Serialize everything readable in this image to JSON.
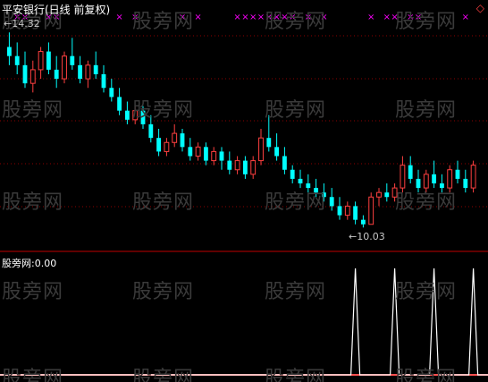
{
  "title": "平安银行(日线 前复权)",
  "corner_icon": "diamond-icon",
  "watermark_text": "股旁网",
  "high_label": "14.32",
  "low_label": "10.03",
  "indicator": {
    "name": "股旁网",
    "separator": ":",
    "value": "0.00"
  },
  "colors": {
    "background": "#000000",
    "up": "#ff4040",
    "down": "#00ffff",
    "grid": "#8b0000",
    "marker": "#ff00ff",
    "spike": "#ffffff",
    "baseline": "#ff5050"
  },
  "chart_data": [
    {
      "type": "candlestick",
      "title": "平安银行(日线 前复权)",
      "y_range": [
        9.8,
        14.6
      ],
      "annotations": [
        {
          "label": "14.32",
          "type": "high"
        },
        {
          "label": "10.03",
          "type": "low"
        }
      ],
      "candles": [
        {
          "o": 14.0,
          "h": 14.32,
          "l": 13.6,
          "c": 13.8
        },
        {
          "o": 13.8,
          "h": 14.1,
          "l": 13.4,
          "c": 13.6
        },
        {
          "o": 13.6,
          "h": 13.9,
          "l": 13.1,
          "c": 13.2
        },
        {
          "o": 13.2,
          "h": 13.7,
          "l": 13.0,
          "c": 13.5
        },
        {
          "o": 13.5,
          "h": 14.0,
          "l": 13.3,
          "c": 13.9
        },
        {
          "o": 13.9,
          "h": 14.1,
          "l": 13.4,
          "c": 13.5
        },
        {
          "o": 13.5,
          "h": 13.8,
          "l": 13.1,
          "c": 13.3
        },
        {
          "o": 13.3,
          "h": 13.9,
          "l": 13.2,
          "c": 13.8
        },
        {
          "o": 13.8,
          "h": 14.2,
          "l": 13.5,
          "c": 13.6
        },
        {
          "o": 13.6,
          "h": 13.8,
          "l": 13.2,
          "c": 13.3
        },
        {
          "o": 13.3,
          "h": 13.7,
          "l": 13.1,
          "c": 13.6
        },
        {
          "o": 13.6,
          "h": 13.9,
          "l": 13.3,
          "c": 13.4
        },
        {
          "o": 13.4,
          "h": 13.6,
          "l": 13.0,
          "c": 13.1
        },
        {
          "o": 13.1,
          "h": 13.3,
          "l": 12.8,
          "c": 12.9
        },
        {
          "o": 12.9,
          "h": 13.1,
          "l": 12.5,
          "c": 12.6
        },
        {
          "o": 12.6,
          "h": 12.8,
          "l": 12.3,
          "c": 12.4
        },
        {
          "o": 12.4,
          "h": 12.7,
          "l": 12.3,
          "c": 12.6
        },
        {
          "o": 12.6,
          "h": 12.7,
          "l": 12.2,
          "c": 12.3
        },
        {
          "o": 12.3,
          "h": 12.5,
          "l": 11.9,
          "c": 12.0
        },
        {
          "o": 12.0,
          "h": 12.2,
          "l": 11.6,
          "c": 11.7
        },
        {
          "o": 11.7,
          "h": 12.0,
          "l": 11.6,
          "c": 11.9
        },
        {
          "o": 11.9,
          "h": 12.3,
          "l": 11.8,
          "c": 12.1
        },
        {
          "o": 12.1,
          "h": 12.2,
          "l": 11.7,
          "c": 11.8
        },
        {
          "o": 11.8,
          "h": 12.0,
          "l": 11.5,
          "c": 11.6
        },
        {
          "o": 11.6,
          "h": 11.9,
          "l": 11.5,
          "c": 11.8
        },
        {
          "o": 11.8,
          "h": 11.9,
          "l": 11.4,
          "c": 11.5
        },
        {
          "o": 11.5,
          "h": 11.8,
          "l": 11.4,
          "c": 11.7
        },
        {
          "o": 11.7,
          "h": 11.8,
          "l": 11.3,
          "c": 11.5
        },
        {
          "o": 11.5,
          "h": 11.7,
          "l": 11.2,
          "c": 11.3
        },
        {
          "o": 11.3,
          "h": 11.6,
          "l": 11.2,
          "c": 11.5
        },
        {
          "o": 11.5,
          "h": 11.6,
          "l": 11.1,
          "c": 11.2
        },
        {
          "o": 11.2,
          "h": 11.6,
          "l": 11.1,
          "c": 11.5
        },
        {
          "o": 11.5,
          "h": 12.2,
          "l": 11.4,
          "c": 12.0
        },
        {
          "o": 12.0,
          "h": 12.5,
          "l": 11.7,
          "c": 11.8
        },
        {
          "o": 11.8,
          "h": 12.1,
          "l": 11.5,
          "c": 11.6
        },
        {
          "o": 11.6,
          "h": 11.8,
          "l": 11.2,
          "c": 11.3
        },
        {
          "o": 11.3,
          "h": 11.4,
          "l": 11.0,
          "c": 11.1
        },
        {
          "o": 11.1,
          "h": 11.3,
          "l": 10.9,
          "c": 11.0
        },
        {
          "o": 11.0,
          "h": 11.2,
          "l": 10.8,
          "c": 10.9
        },
        {
          "o": 10.9,
          "h": 11.1,
          "l": 10.7,
          "c": 10.8
        },
        {
          "o": 10.8,
          "h": 11.0,
          "l": 10.6,
          "c": 10.7
        },
        {
          "o": 10.7,
          "h": 10.9,
          "l": 10.4,
          "c": 10.5
        },
        {
          "o": 10.5,
          "h": 10.7,
          "l": 10.2,
          "c": 10.3
        },
        {
          "o": 10.3,
          "h": 10.6,
          "l": 10.2,
          "c": 10.5
        },
        {
          "o": 10.5,
          "h": 10.6,
          "l": 10.1,
          "c": 10.2
        },
        {
          "o": 10.2,
          "h": 10.3,
          "l": 10.03,
          "c": 10.1
        },
        {
          "o": 10.1,
          "h": 10.8,
          "l": 10.1,
          "c": 10.7
        },
        {
          "o": 10.7,
          "h": 10.9,
          "l": 10.5,
          "c": 10.8
        },
        {
          "o": 10.8,
          "h": 11.0,
          "l": 10.6,
          "c": 10.7
        },
        {
          "o": 10.7,
          "h": 11.0,
          "l": 10.6,
          "c": 10.9
        },
        {
          "o": 10.9,
          "h": 11.6,
          "l": 10.8,
          "c": 11.4
        },
        {
          "o": 11.4,
          "h": 11.6,
          "l": 11.0,
          "c": 11.1
        },
        {
          "o": 11.1,
          "h": 11.3,
          "l": 10.8,
          "c": 10.9
        },
        {
          "o": 10.9,
          "h": 11.3,
          "l": 10.8,
          "c": 11.2
        },
        {
          "o": 11.2,
          "h": 11.5,
          "l": 10.9,
          "c": 11.0
        },
        {
          "o": 11.0,
          "h": 11.2,
          "l": 10.8,
          "c": 10.9
        },
        {
          "o": 10.9,
          "h": 11.4,
          "l": 10.8,
          "c": 11.3
        },
        {
          "o": 11.3,
          "h": 11.5,
          "l": 11.0,
          "c": 11.1
        },
        {
          "o": 11.1,
          "h": 11.3,
          "l": 10.8,
          "c": 10.9
        },
        {
          "o": 10.9,
          "h": 11.5,
          "l": 10.8,
          "c": 11.4
        }
      ]
    },
    {
      "type": "line",
      "name": "股旁网",
      "value_label": "0.00",
      "spikes_at_index": [
        44,
        49,
        54,
        59
      ],
      "baseline": 0,
      "spike_value": 1
    }
  ],
  "markers": {
    "symbol": "×",
    "indices": [
      1,
      2,
      5,
      6,
      14,
      16,
      22,
      24,
      29,
      30,
      31,
      32,
      33,
      34,
      35,
      36,
      38,
      40,
      46,
      48,
      49,
      51,
      52,
      58
    ]
  }
}
